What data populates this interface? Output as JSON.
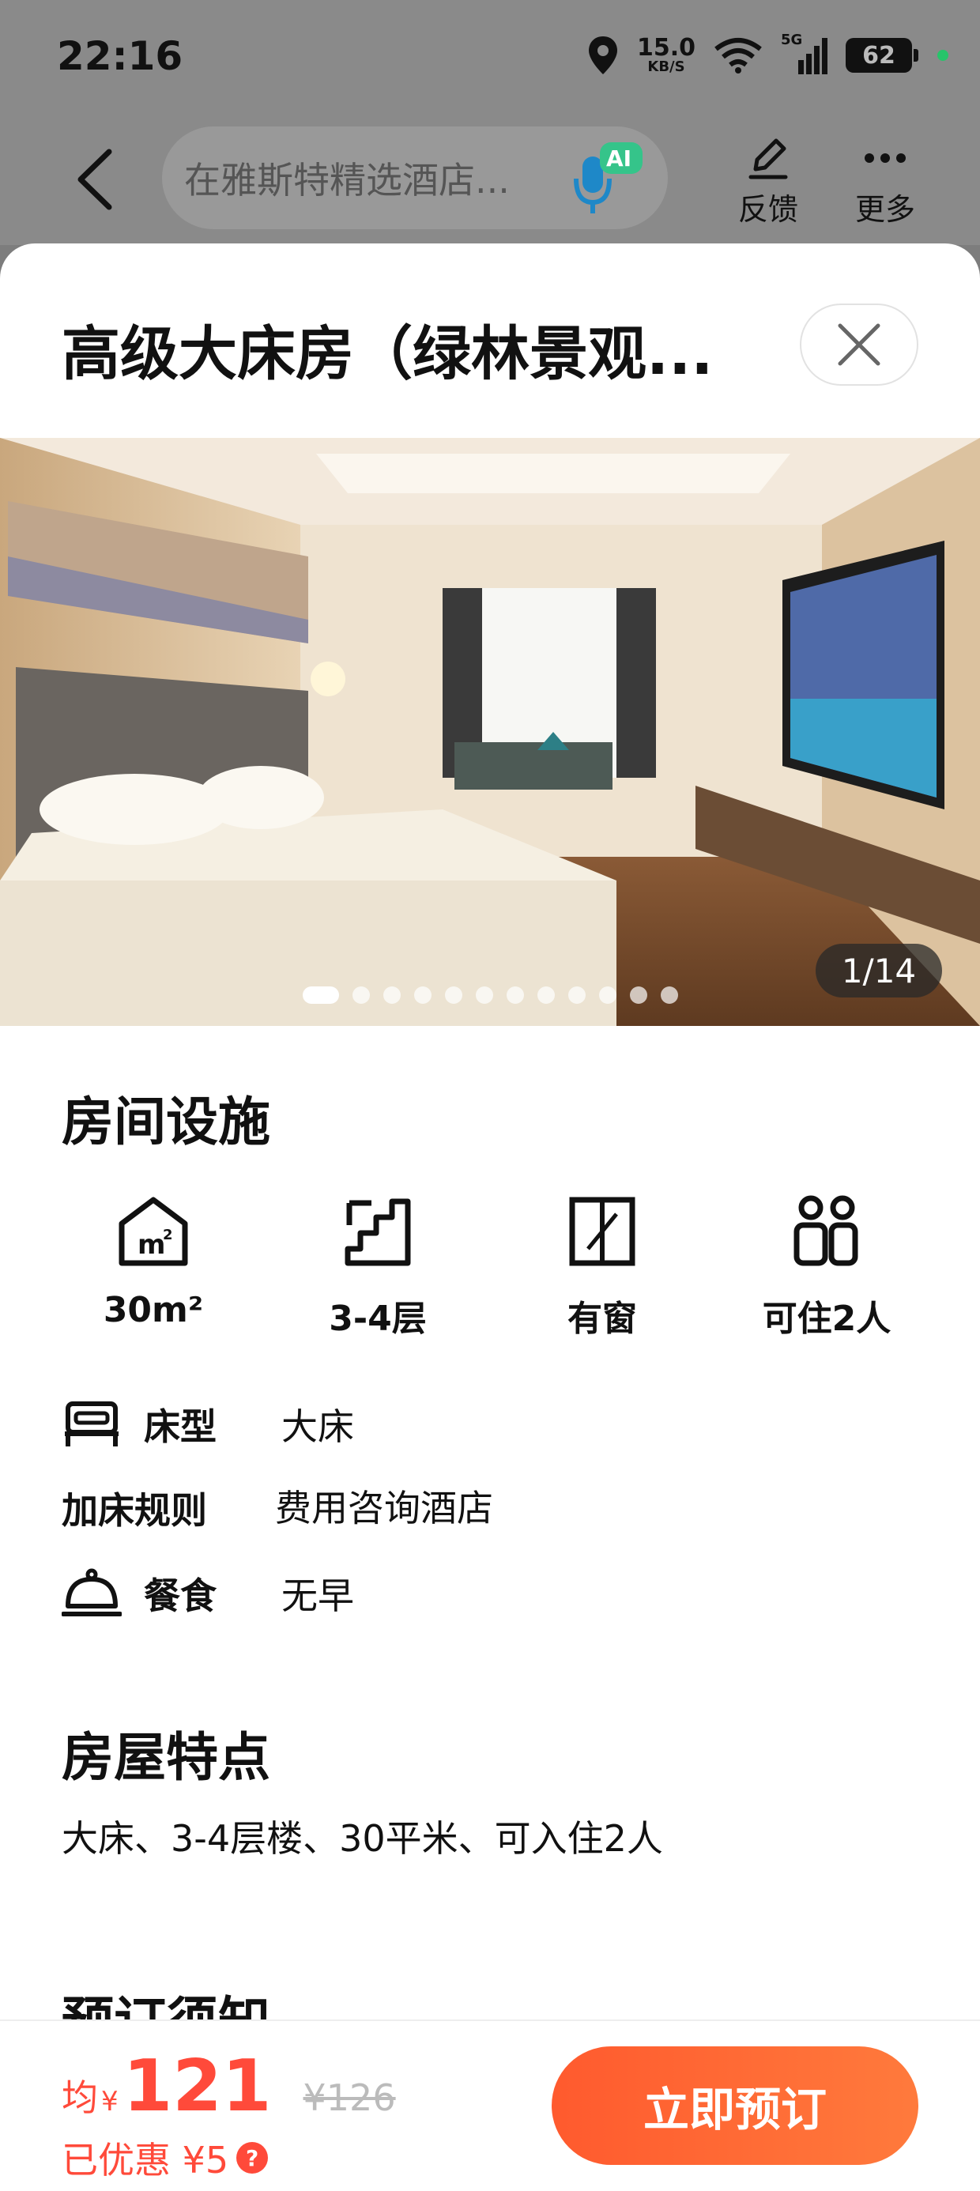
{
  "status_bar": {
    "time": "22:16",
    "net_speed_value": "15.0",
    "net_speed_unit": "KB/S",
    "signal_label": "5G",
    "battery": "62"
  },
  "nav": {
    "search_placeholder": "在雅斯特精选酒店...",
    "ai_badge": "AI",
    "feedback_label": "反馈",
    "more_label": "更多"
  },
  "room": {
    "title": "高级大床房（绿林景观...",
    "photo_counter": "1/14",
    "photo_count": 14,
    "photo_index": 1
  },
  "facilities": {
    "title": "房间设施",
    "items": [
      {
        "icon": "area-icon",
        "label": "30m²"
      },
      {
        "icon": "stairs-icon",
        "label": "3-4层"
      },
      {
        "icon": "window-icon",
        "label": "有窗"
      },
      {
        "icon": "guests-icon",
        "label": "可住2人"
      }
    ]
  },
  "details": {
    "bed_key": "床型",
    "bed_val": "大床",
    "extra_bed_key": "加床规则",
    "extra_bed_val": "费用咨询酒店",
    "meal_key": "餐食",
    "meal_val": "无早"
  },
  "features": {
    "title": "房屋特点",
    "text": "大床、3-4层楼、30平米、可入住2人"
  },
  "notice": {
    "title": "预订须知"
  },
  "booking": {
    "price_prefix": "均",
    "currency": "¥",
    "price": "121",
    "original_price": "¥126",
    "discount": "已优惠 ¥5",
    "help_mark": "?",
    "book_label": "立即预订"
  },
  "colors": {
    "accent": "#ff4a3a",
    "button_start": "#ff5a2e",
    "button_end": "#ff7a3c"
  }
}
